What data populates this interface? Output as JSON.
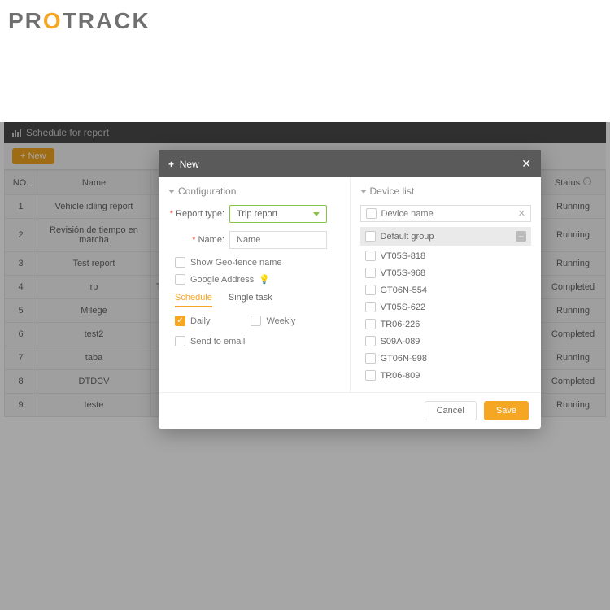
{
  "brand": "PROTRACK",
  "page_title": "Schedule for report",
  "toolbar": {
    "new_label": "New"
  },
  "table": {
    "headers": {
      "no": "NO.",
      "name": "Name",
      "status": "Status"
    },
    "rows": [
      {
        "no": "1",
        "name": "Vehicle idling report",
        "status": "Running"
      },
      {
        "no": "2",
        "name": "Revisión de tiempo en marcha",
        "status": "Running"
      },
      {
        "no": "3",
        "name": "Test report",
        "status": "Running"
      },
      {
        "no": "4",
        "name": "rp",
        "extra": "Trip",
        "status": "Completed"
      },
      {
        "no": "5",
        "name": "Milege",
        "status": "Running"
      },
      {
        "no": "6",
        "name": "test2",
        "status": "Completed"
      },
      {
        "no": "7",
        "name": "taba",
        "status": "Running"
      },
      {
        "no": "8",
        "name": "DTDCV",
        "status": "Completed"
      },
      {
        "no": "9",
        "name": "teste",
        "status": "Running"
      }
    ]
  },
  "modal": {
    "title": "New",
    "config": {
      "section": "Configuration",
      "report_type_label": "Report type:",
      "report_type_value": "Trip report",
      "name_label": "Name:",
      "name_placeholder": "Name",
      "geofence_label": "Show Geo-fence name",
      "google_label": "Google Address",
      "tabs": {
        "schedule": "Schedule",
        "single": "Single task"
      },
      "daily_label": "Daily",
      "weekly_label": "Weekly",
      "email_label": "Send to email"
    },
    "devices": {
      "section": "Device list",
      "search_placeholder": "Device name",
      "group": "Default group",
      "items": [
        "VT05S-818",
        "VT05S-968",
        "GT06N-554",
        "VT05S-622",
        "TR06-226",
        "S09A-089",
        "GT06N-998",
        "TR06-809"
      ]
    },
    "footer": {
      "cancel": "Cancel",
      "save": "Save"
    }
  }
}
